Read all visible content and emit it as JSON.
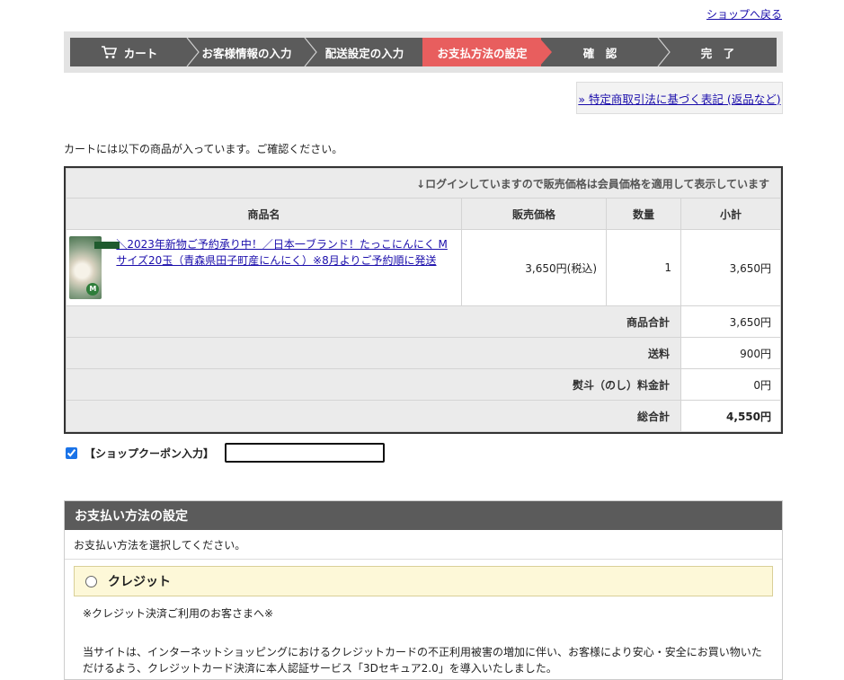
{
  "header": {
    "back_link": "ショップへ戻る"
  },
  "steps": [
    {
      "label": "カート",
      "active": false
    },
    {
      "label": "お客様情報の入力",
      "active": false
    },
    {
      "label": "配送設定の入力",
      "active": false
    },
    {
      "label": "お支払方法の設定",
      "active": true
    },
    {
      "label": "確　認",
      "active": false
    },
    {
      "label": "完　了",
      "active": false
    }
  ],
  "legal_link": "» 特定商取引法に基づく表記 (返品など)",
  "cart": {
    "intro": "カートには以下の商品が入っています。ご確認ください。",
    "notice": "↓ログインしていますので販売価格は会員価格を適用して表示しています",
    "columns": [
      "商品名",
      "販売価格",
      "数量",
      "小計"
    ],
    "item": {
      "name": "＼2023年新物ご予約承り中！／日本一ブランド！たっこにんにく Mサイズ20玉（青森県田子町産にんにく）※8月よりご予約順に発送",
      "price": "3,650円(税込)",
      "qty": "1",
      "subtotal": "3,650円"
    },
    "summary": [
      {
        "label": "商品合計",
        "value": "3,650円"
      },
      {
        "label": "送料",
        "value": "900円"
      },
      {
        "label": "熨斗（のし）料金計",
        "value": "0円"
      },
      {
        "label": "総合計",
        "value": "4,550円"
      }
    ]
  },
  "coupon": {
    "label": "【ショップクーポン入力】",
    "checked": true,
    "value": ""
  },
  "payment": {
    "title": "お支払い方法の設定",
    "instruction": "お支払い方法を選択してください。",
    "option_label": "クレジット",
    "note": "※クレジット決済ご利用のお客さまへ※",
    "description": "当サイトは、インターネットショッピングにおけるクレジットカードの不正利用被害の増加に伴い、お客様により安心・安全にお買い物いただけるよう、クレジットカード決済に本人認証サービス「3Dセキュア2.0」を導入いたしました。"
  }
}
